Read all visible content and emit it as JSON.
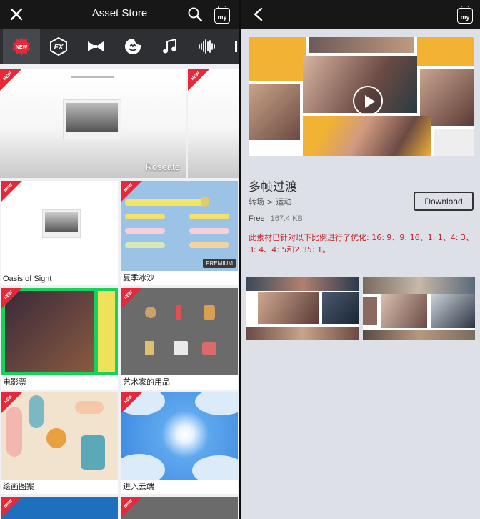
{
  "left": {
    "header": {
      "title": "Asset Store",
      "my_label": "my"
    },
    "categories": [
      {
        "icon": "new-badge-icon",
        "label": "NEW",
        "active": true
      },
      {
        "icon": "fx-icon",
        "label": "FX"
      },
      {
        "icon": "bowtie-icon"
      },
      {
        "icon": "sticker-icon"
      },
      {
        "icon": "music-note-icon"
      },
      {
        "icon": "waveform-icon"
      }
    ],
    "featured": {
      "label": "Roseate"
    },
    "new_ribbon": "NEW",
    "items": [
      {
        "name": "Oasis of Sight"
      },
      {
        "name": "夏季冰沙",
        "badge": "PREMIUM"
      },
      {
        "name": "电影票"
      },
      {
        "name": "艺术家的用品"
      },
      {
        "name": "绘画图案"
      },
      {
        "name": "进入云端"
      }
    ]
  },
  "right": {
    "header": {
      "my_label": "my"
    },
    "detail": {
      "title": "多帧过渡",
      "category": "转场 > 运动",
      "download_label": "Download",
      "price": "Free",
      "size": "167.4 KB",
      "description": "此素材已针对以下比例进行了优化: 16: 9、9: 16、1: 1、4: 3、3: 4、4: 5和2.35: 1。"
    }
  },
  "colors": {
    "accent_red": "#e5283a",
    "header_bg": "#171717",
    "category_bg": "#2d2f33"
  }
}
